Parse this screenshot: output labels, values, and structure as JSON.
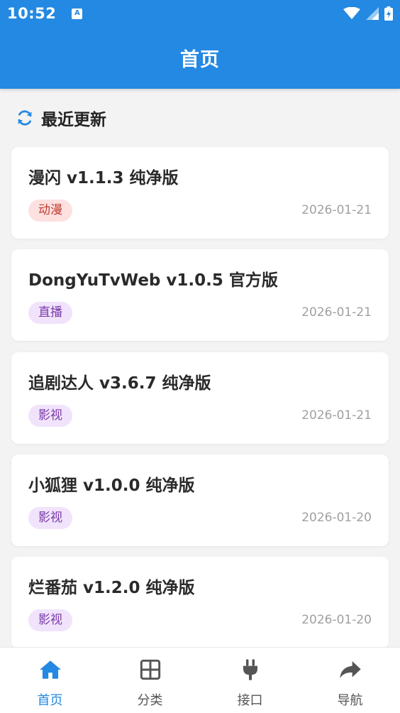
{
  "status_bar": {
    "time": "10:52",
    "a_badge": "A",
    "icons": [
      "wifi-icon",
      "signal-icon",
      "battery-icon"
    ]
  },
  "app_bar": {
    "title": "首页"
  },
  "section": {
    "title": "最近更新",
    "icon": "refresh-icon"
  },
  "colors": {
    "primary": "#2389e3",
    "tag_red_bg": "#fde0e0",
    "tag_red_text": "#c0392b",
    "tag_purple_bg": "#f0e3fb",
    "tag_purple_text": "#7a3aa8"
  },
  "cards": [
    {
      "title": "漫闪 v1.1.3 纯净版",
      "tag": "动漫",
      "tag_color": "red",
      "date": "2026-01-21"
    },
    {
      "title": "DongYuTvWeb v1.0.5 官方版",
      "tag": "直播",
      "tag_color": "purple",
      "date": "2026-01-21"
    },
    {
      "title": "追剧达人 v3.6.7 纯净版",
      "tag": "影视",
      "tag_color": "purple",
      "date": "2026-01-21"
    },
    {
      "title": "小狐狸 v1.0.0 纯净版",
      "tag": "影视",
      "tag_color": "purple",
      "date": "2026-01-20"
    },
    {
      "title": "烂番茄 v1.2.0 纯净版",
      "tag": "影视",
      "tag_color": "purple",
      "date": "2026-01-20"
    }
  ],
  "bottom_nav": [
    {
      "label": "首页",
      "icon": "home-icon",
      "active": true
    },
    {
      "label": "分类",
      "icon": "grid-icon",
      "active": false
    },
    {
      "label": "接口",
      "icon": "plug-icon",
      "active": false
    },
    {
      "label": "导航",
      "icon": "share-icon",
      "active": false
    }
  ]
}
